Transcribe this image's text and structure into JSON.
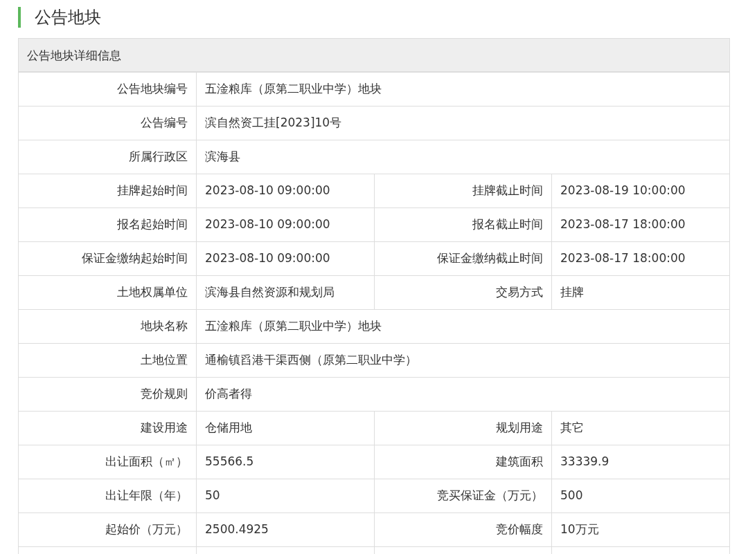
{
  "title": "公告地块",
  "panel": {
    "heading": "公告地块详细信息",
    "rows": [
      {
        "kind": "single",
        "fields": [
          {
            "label": "公告地块编号",
            "value": "五淦粮库（原第二职业中学）地块"
          }
        ]
      },
      {
        "kind": "single",
        "fields": [
          {
            "label": "公告编号",
            "value": "滨自然资工挂[2023]10号"
          }
        ]
      },
      {
        "kind": "single",
        "fields": [
          {
            "label": "所属行政区",
            "value": "滨海县"
          }
        ]
      },
      {
        "kind": "pair",
        "fields": [
          {
            "label": "挂牌起始时间",
            "value": "2023-08-10 09:00:00"
          },
          {
            "label": "挂牌截止时间",
            "value": "2023-08-19 10:00:00"
          }
        ]
      },
      {
        "kind": "pair",
        "fields": [
          {
            "label": "报名起始时间",
            "value": "2023-08-10 09:00:00"
          },
          {
            "label": "报名截止时间",
            "value": "2023-08-17 18:00:00"
          }
        ]
      },
      {
        "kind": "pair",
        "fields": [
          {
            "label": "保证金缴纳起始时间",
            "value": "2023-08-10 09:00:00"
          },
          {
            "label": "保证金缴纳截止时间",
            "value": "2023-08-17 18:00:00"
          }
        ]
      },
      {
        "kind": "pair",
        "fields": [
          {
            "label": "土地权属单位",
            "value": "滨海县自然资源和规划局"
          },
          {
            "label": "交易方式",
            "value": "挂牌"
          }
        ]
      },
      {
        "kind": "single",
        "fields": [
          {
            "label": "地块名称",
            "value": "五淦粮库（原第二职业中学）地块"
          }
        ]
      },
      {
        "kind": "single",
        "fields": [
          {
            "label": "土地位置",
            "value": "通榆镇舀港干渠西侧（原第二职业中学）"
          }
        ]
      },
      {
        "kind": "single",
        "fields": [
          {
            "label": "竞价规则",
            "value": "价高者得"
          }
        ]
      },
      {
        "kind": "pair",
        "fields": [
          {
            "label": "建设用途",
            "value": "仓储用地"
          },
          {
            "label": "规划用途",
            "value": "其它"
          }
        ]
      },
      {
        "kind": "pair",
        "fields": [
          {
            "label": "出让面积（㎡）",
            "value": "55566.5"
          },
          {
            "label": "建筑面积",
            "value": "33339.9"
          }
        ]
      },
      {
        "kind": "pair",
        "fields": [
          {
            "label": "出让年限（年）",
            "value": "50"
          },
          {
            "label": "竞买保证金（万元）",
            "value": "500"
          }
        ]
      },
      {
        "kind": "pair",
        "fields": [
          {
            "label": "起始价（万元）",
            "value": "2500.4925"
          },
          {
            "label": "竞价幅度",
            "value": "10万元"
          }
        ]
      }
    ]
  }
}
